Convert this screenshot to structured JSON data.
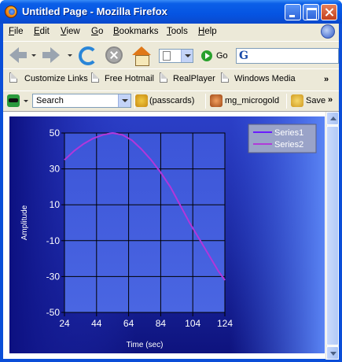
{
  "window": {
    "title": "Untitled Page - Mozilla Firefox"
  },
  "menu": [
    "File",
    "Edit",
    "View",
    "Go",
    "Bookmarks",
    "Tools",
    "Help"
  ],
  "nav": {
    "go_label": "Go"
  },
  "bookmarks": {
    "items": [
      "Customize Links",
      "Free Hotmail",
      "RealPlayer",
      "Windows Media"
    ],
    "chevron": "»"
  },
  "search_toolbar": {
    "search_value": "Search",
    "passcards_label": "(passcards)",
    "user_label": "mg_microgold",
    "save_label": "Save",
    "chevron": "»"
  },
  "colors": {
    "series1": "#6a1cff",
    "series2": "#b03ad8"
  },
  "chart_data": {
    "type": "line",
    "xlabel": "Time (sec)",
    "ylabel": "Amplitude",
    "xlim": [
      24,
      124
    ],
    "ylim": [
      -50,
      50
    ],
    "xticks": [
      24,
      44,
      64,
      84,
      104,
      124
    ],
    "yticks": [
      50,
      30,
      10,
      -10,
      -30,
      -50
    ],
    "grid": true,
    "legend_position": "top-right",
    "series": [
      {
        "name": "Series1",
        "x": [
          24,
          30,
          36,
          42,
          48,
          54,
          60,
          66,
          72,
          78,
          84,
          90,
          96,
          102,
          108,
          114,
          120,
          124
        ],
        "y": [
          35,
          40,
          44,
          47,
          49,
          50,
          49,
          46,
          41,
          35,
          28,
          20,
          10,
          0,
          -9,
          -18,
          -27,
          -32
        ]
      },
      {
        "name": "Series2",
        "x": [
          24,
          30,
          36,
          42,
          48,
          54,
          60,
          66,
          72,
          78,
          84,
          90,
          96,
          102,
          108,
          114,
          120,
          124
        ],
        "y": [
          35,
          40,
          44,
          47,
          49,
          50,
          49,
          46,
          41,
          35,
          28,
          20,
          10,
          0,
          -9,
          -18,
          -27,
          -32
        ]
      }
    ]
  }
}
